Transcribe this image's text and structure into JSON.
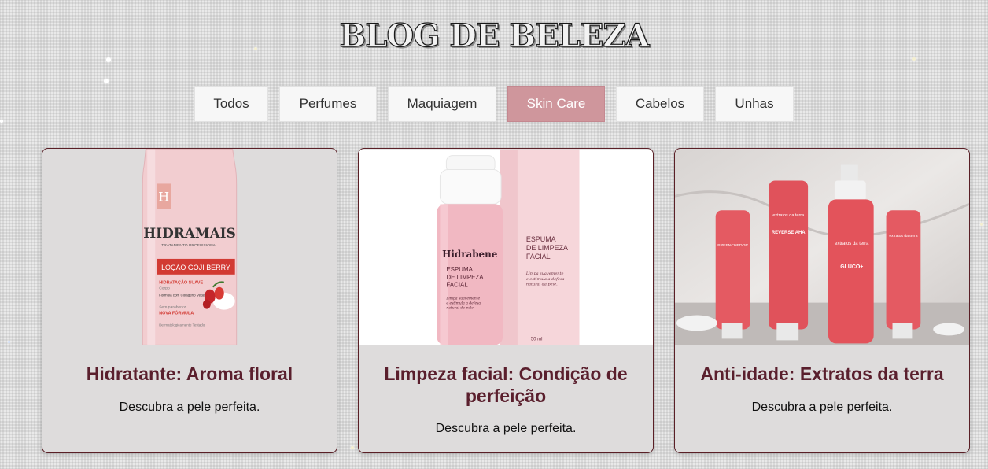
{
  "page": {
    "title": "BLOG DE BELEZA"
  },
  "filters": [
    {
      "label": "Todos",
      "active": false
    },
    {
      "label": "Perfumes",
      "active": false
    },
    {
      "label": "Maquiagem",
      "active": false
    },
    {
      "label": "Skin Care",
      "active": true
    },
    {
      "label": "Cabelos",
      "active": false
    },
    {
      "label": "Unhas",
      "active": false
    }
  ],
  "colors": {
    "accent": "#cf969c",
    "title_text": "#5a1f2d",
    "card_border": "#5a1f26"
  },
  "cards": [
    {
      "title": "Hidratante: Aroma floral",
      "description": "Descubra a pele perfeita.",
      "image": {
        "brand": "HIDRAMAIS",
        "tagline": "TRATAMENTO PROFISSIONAL",
        "product": "LOÇÃO GOJI BERRY",
        "line1": "HIDRATAÇÃO SUAVE",
        "line2": "Corpo",
        "line3": "Fórmula com Colágeno Vegetal Pantenol",
        "line4": "Sem parabenos",
        "line5": "NOVA FÓRMULA",
        "footer": "Dermatologicamente Testado"
      }
    },
    {
      "title": "Limpeza facial: Condição de perfeição",
      "description": "Descubra a pele perfeita.",
      "image": {
        "brand": "Hidrabene",
        "product": "ESPUMA DE LIMPEZA FACIAL",
        "box_text": "ESPUMA DE LIMPEZA FACIAL",
        "claim": "Limpa suavemente e estimula a defesa natural da pele.",
        "volume": "50 ml"
      }
    },
    {
      "title": "Anti-idade: Extratos da terra",
      "description": "Descubra a pele perfeita.",
      "image": {
        "brand": "extratos da terra",
        "labels": [
          "REVERSE AHA",
          "GLUCO+",
          "PREENCHEDOR"
        ]
      }
    }
  ]
}
